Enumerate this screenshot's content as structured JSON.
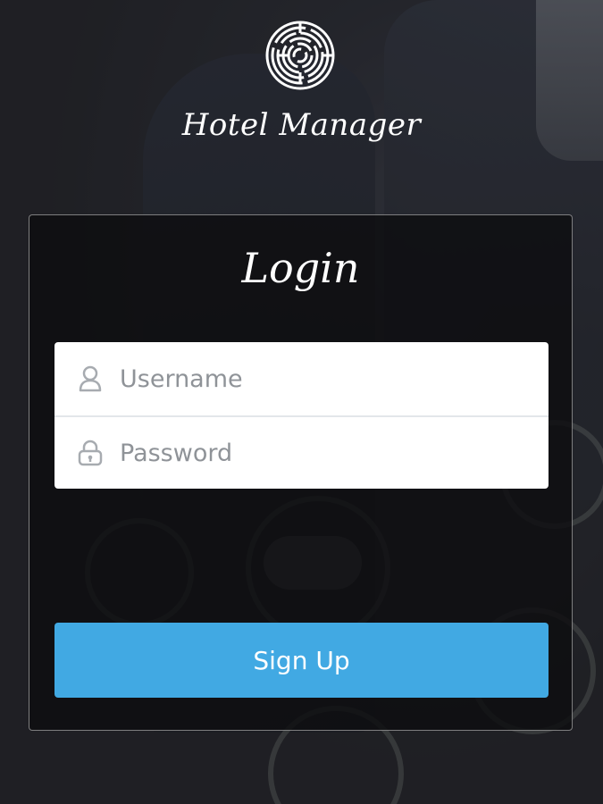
{
  "app": {
    "title": "Hotel Manager"
  },
  "login": {
    "title": "Login",
    "username": {
      "placeholder": "Username",
      "value": "",
      "icon": "user-icon"
    },
    "password": {
      "placeholder": "Password",
      "value": "",
      "icon": "lock-icon"
    },
    "signup_label": "Sign Up"
  },
  "colors": {
    "button": "#41a9e3",
    "card_bg": "#0e0e10",
    "input_bg": "#ffffff",
    "placeholder": "#8f9398"
  }
}
